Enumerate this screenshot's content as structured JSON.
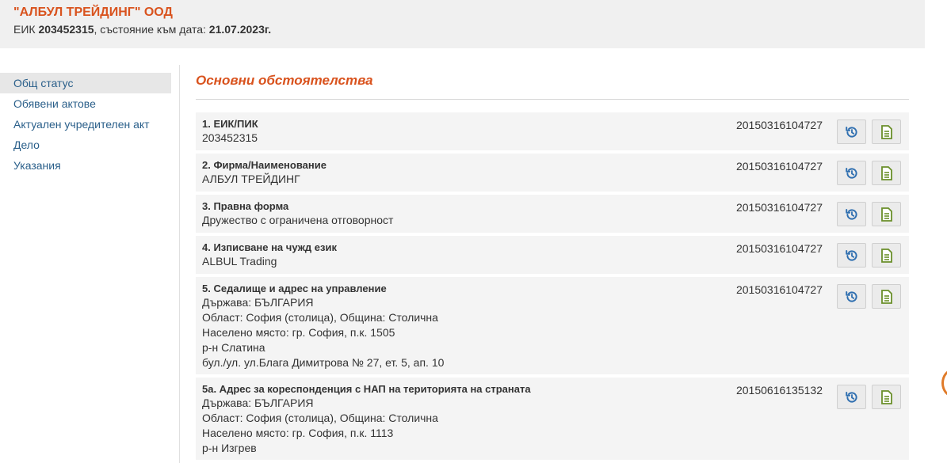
{
  "header": {
    "company_name": "\"АЛБУЛ ТРЕЙДИНГ\" ООД",
    "eik_label": "ЕИК ",
    "eik_value": "203452315",
    "state_label": ", състояние към дата: ",
    "state_date": "21.07.2023г."
  },
  "sidebar": {
    "items": [
      {
        "label": "Общ статус",
        "active": true
      },
      {
        "label": "Обявени актове",
        "active": false
      },
      {
        "label": "Актуален учредителен акт",
        "active": false
      },
      {
        "label": "Дело",
        "active": false
      },
      {
        "label": "Указания",
        "active": false
      }
    ]
  },
  "main": {
    "title": "Основни обстоятелства",
    "rows": [
      {
        "title": "1. ЕИК/ПИК",
        "lines": [
          "203452315"
        ],
        "date": "20150316104727"
      },
      {
        "title": "2. Фирма/Наименование",
        "lines": [
          "АЛБУЛ ТРЕЙДИНГ"
        ],
        "date": "20150316104727"
      },
      {
        "title": "3. Правна форма",
        "lines": [
          "Дружество с ограничена отговорност"
        ],
        "date": "20150316104727"
      },
      {
        "title": "4. Изписване на чужд език",
        "lines": [
          "ALBUL Trading"
        ],
        "date": "20150316104727"
      },
      {
        "title": "5. Седалище и адрес на управление",
        "lines": [
          "Държава: БЪЛГАРИЯ",
          "Област: София (столица), Община: Столична",
          "Населено място: гр. София, п.к. 1505",
          "р-н Слатина",
          "бул./ул. ул.Блага Димитрова № 27, ет. 5, ап. 10"
        ],
        "date": "20150316104727"
      },
      {
        "title": "5а. Адрес за кореспонденция с НАП на територията на страната",
        "lines": [
          "Държава: БЪЛГАРИЯ",
          "Област: София (столица), Община: Столична",
          "Населено място: гр. София, п.к. 1113",
          "р-н Изгрев"
        ],
        "date": "20150616135132"
      }
    ]
  },
  "icons": {
    "history": "history-icon",
    "document": "document-icon"
  },
  "colors": {
    "accent": "#d9531e",
    "link": "#2a5f8a",
    "history_icon": "#2f6fb0",
    "doc_icon": "#6a8f2a"
  }
}
